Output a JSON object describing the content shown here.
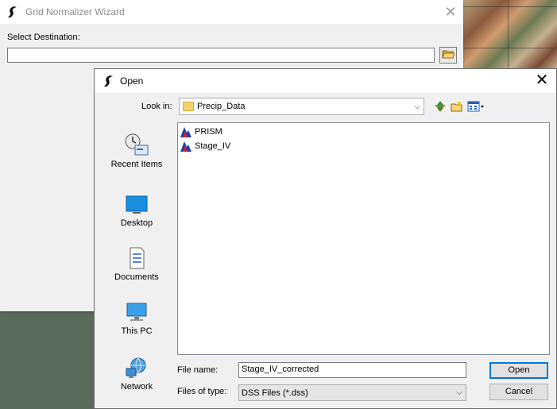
{
  "wizard": {
    "title": "Grid Normalizer Wizard",
    "select_destination_label": "Select Destination:",
    "destination_value": ""
  },
  "dialog": {
    "title": "Open",
    "look_in_label": "Look in:",
    "look_in_value": "Precip_Data",
    "places": [
      {
        "label": "Recent Items",
        "icon": "recent-items-icon"
      },
      {
        "label": "Desktop",
        "icon": "desktop-icon"
      },
      {
        "label": "Documents",
        "icon": "documents-icon"
      },
      {
        "label": "This PC",
        "icon": "this-pc-icon"
      },
      {
        "label": "Network",
        "icon": "network-icon"
      }
    ],
    "files": [
      {
        "name": "PRISM",
        "icon": "dss-file-icon"
      },
      {
        "name": "Stage_IV",
        "icon": "dss-file-icon"
      }
    ],
    "file_name_label": "File name:",
    "file_name_value": "Stage_IV_corrected",
    "files_of_type_label": "Files of type:",
    "files_of_type_value": "DSS Files (*.dss)",
    "open_button": "Open",
    "cancel_button": "Cancel"
  },
  "colors": {
    "dialog_bg": "#f0f0f0",
    "accent": "#0078d7",
    "folder": "#f2d36b"
  }
}
